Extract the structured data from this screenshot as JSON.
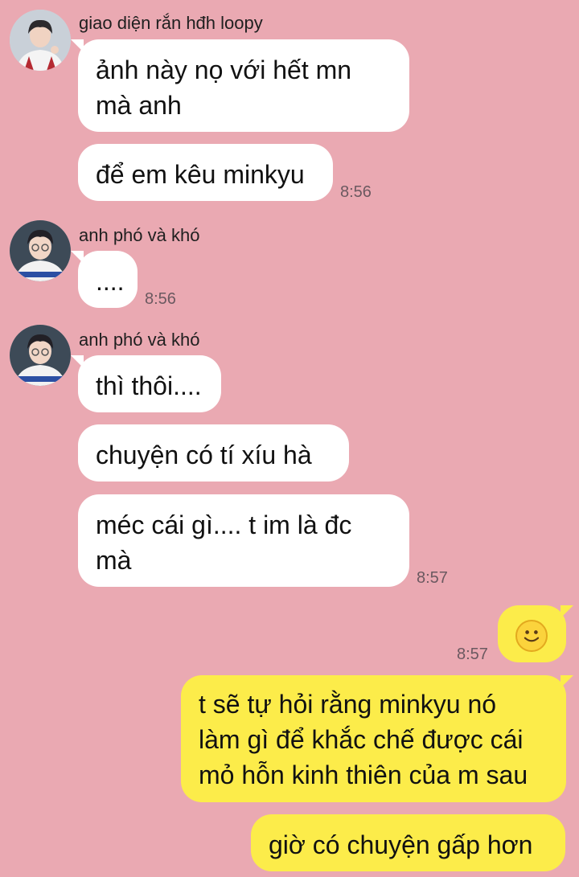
{
  "messages": [
    {
      "sender": "giao diện rắn hđh loopy",
      "bubbles": [
        "ảnh này nọ với hết mn\nmà anh",
        "để em kêu minkyu"
      ],
      "time": "8:56"
    },
    {
      "sender": "anh phó và khó",
      "bubbles": [
        "...."
      ],
      "time": "8:56"
    },
    {
      "sender": "anh phó và khó",
      "bubbles": [
        "thì thôi....",
        "chuyện có tí xíu hà",
        "méc cái gì.... t im là đc\nmà"
      ],
      "time": "8:57"
    },
    {
      "sender": "me",
      "bubbles": [
        "🙂",
        "t sẽ tự hỏi rằng minkyu nó\nlàm gì để khắc chế được cái\nmỏ hỗn kinh thiên của m sau",
        "giờ có chuyện gấp hơn"
      ],
      "time": "8:57"
    }
  ],
  "icons": {
    "emoji": "slightly-smiling-face-icon",
    "avatar_1": "avatar-photo-icon",
    "avatar_2": "avatar-photo-icon"
  },
  "colors": {
    "background": "#eaa9b2",
    "incoming_bubble": "#ffffff",
    "outgoing_bubble": "#fcec4a",
    "timestamp": "#6b5960"
  }
}
